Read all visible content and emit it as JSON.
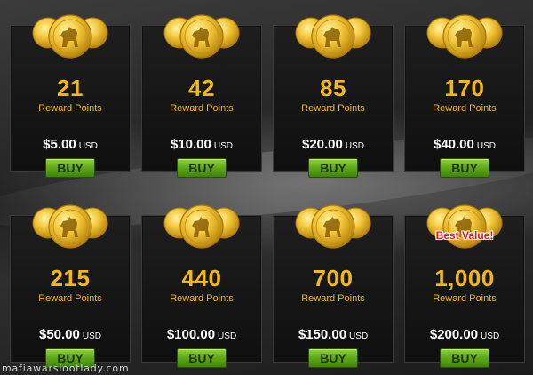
{
  "packages": [
    {
      "points": "21",
      "label": "Reward Points",
      "price": "$5.00",
      "currency": "USD",
      "button": "BUY"
    },
    {
      "points": "42",
      "label": "Reward Points",
      "price": "$10.00",
      "currency": "USD",
      "button": "BUY"
    },
    {
      "points": "85",
      "label": "Reward Points",
      "price": "$20.00",
      "currency": "USD",
      "button": "BUY"
    },
    {
      "points": "170",
      "label": "Reward Points",
      "price": "$40.00",
      "currency": "USD",
      "button": "BUY"
    },
    {
      "points": "215",
      "label": "Reward Points",
      "price": "$50.00",
      "currency": "USD",
      "button": "BUY"
    },
    {
      "points": "440",
      "label": "Reward Points",
      "price": "$100.00",
      "currency": "USD",
      "button": "BUY"
    },
    {
      "points": "700",
      "label": "Reward Points",
      "price": "$150.00",
      "currency": "USD",
      "button": "BUY"
    },
    {
      "points": "1,000",
      "label": "Reward Points",
      "price": "$200.00",
      "currency": "USD",
      "button": "BUY",
      "badge": "Best Value!"
    }
  ],
  "icons": {
    "coin": "gold-coin-stack-icon"
  },
  "colors": {
    "points": "#f3b812",
    "buy_button": "#5fa81a",
    "badge": "#e3160f"
  },
  "watermark": "mafiawarslootlady.com"
}
